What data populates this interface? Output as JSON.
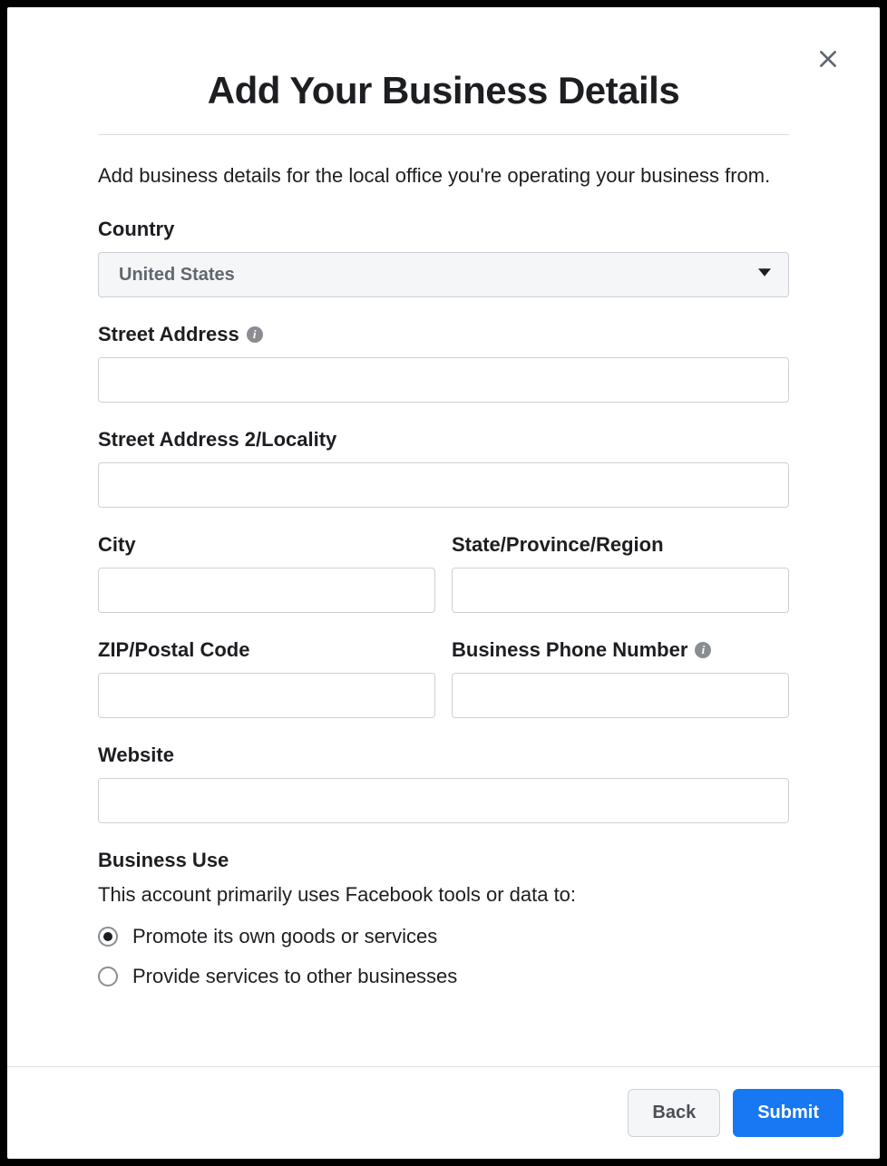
{
  "modal": {
    "title": "Add Your Business Details",
    "subtitle": "Add business details for the local office you're operating your business from."
  },
  "form": {
    "country": {
      "label": "Country",
      "value": "United States"
    },
    "street1": {
      "label": "Street Address",
      "value": ""
    },
    "street2": {
      "label": "Street Address 2/Locality",
      "value": ""
    },
    "city": {
      "label": "City",
      "value": ""
    },
    "state": {
      "label": "State/Province/Region",
      "value": ""
    },
    "zip": {
      "label": "ZIP/Postal Code",
      "value": ""
    },
    "phone": {
      "label": "Business Phone Number",
      "value": ""
    },
    "website": {
      "label": "Website",
      "value": ""
    },
    "business_use": {
      "label": "Business Use",
      "prompt": "This account primarily uses Facebook tools or data to:",
      "options": {
        "promote": "Promote its own goods or services",
        "provide": "Provide services to other businesses"
      },
      "selected": "promote"
    }
  },
  "footer": {
    "back": "Back",
    "submit": "Submit"
  }
}
